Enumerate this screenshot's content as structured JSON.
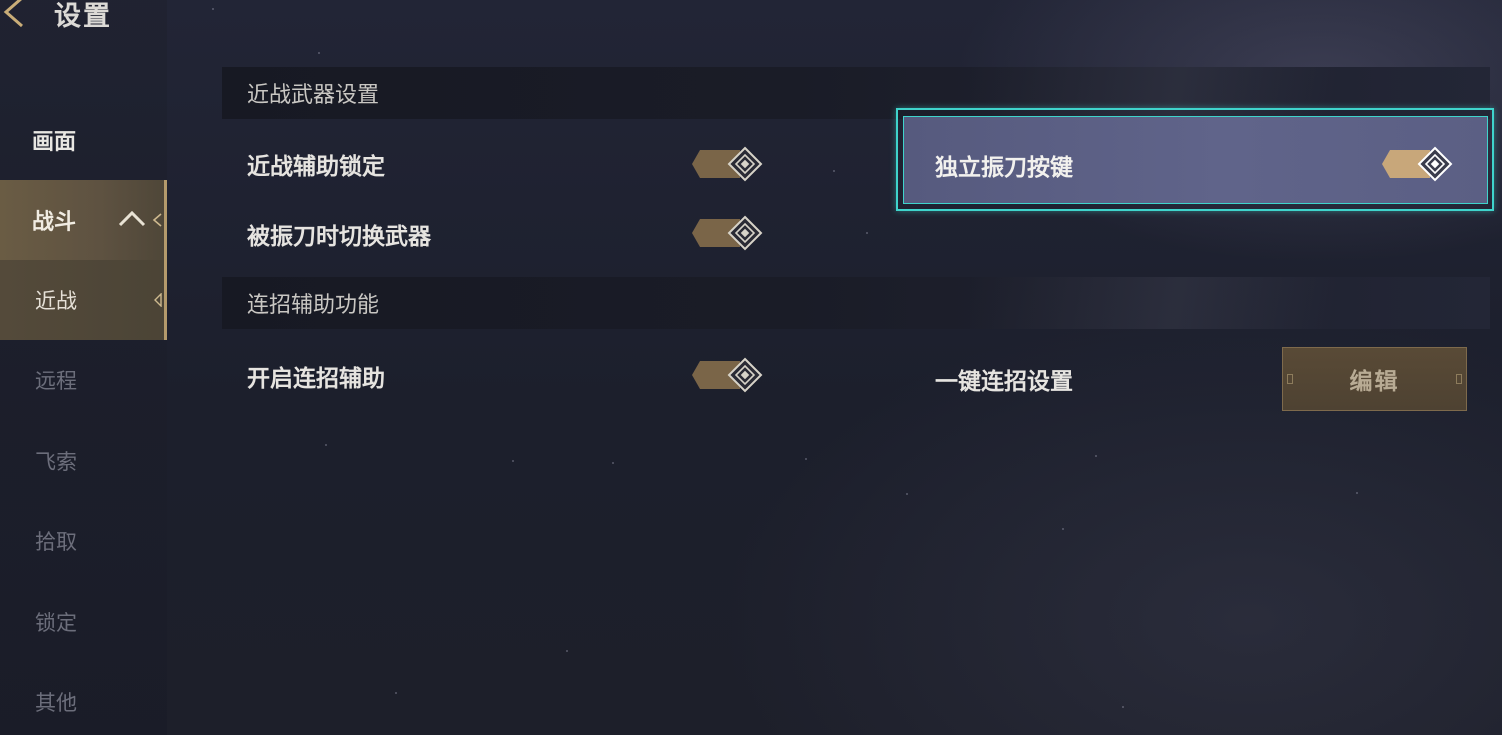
{
  "header": {
    "title": "设置"
  },
  "sidebar": {
    "items": [
      {
        "label": "画面"
      },
      {
        "label": "战斗"
      },
      {
        "label": "近战"
      },
      {
        "label": "远程"
      },
      {
        "label": "飞索"
      },
      {
        "label": "拾取"
      },
      {
        "label": "锁定"
      },
      {
        "label": "其他"
      }
    ]
  },
  "sections": [
    {
      "title": "近战武器设置",
      "settings": [
        {
          "label": "近战辅助锁定",
          "toggle_on": true
        },
        {
          "label": "独立振刀按键",
          "toggle_on": true,
          "highlighted": true
        },
        {
          "label": "被振刀时切换武器",
          "toggle_on": true
        }
      ]
    },
    {
      "title": "连招辅助功能",
      "settings": [
        {
          "label": "开启连招辅助",
          "toggle_on": true
        },
        {
          "label": "一键连招设置",
          "button_label": "编辑"
        }
      ]
    }
  ],
  "colors": {
    "accent_gold": "#b49a6c",
    "toggle_tan": "#7a6548",
    "highlight_cyan": "#3fd4cc",
    "highlight_fill": "#5c6086"
  },
  "icons": {
    "back": "back-arrow-icon",
    "category_collapse": "chevron-up-icon",
    "toggle_knob": "diamond-knob-icon"
  }
}
